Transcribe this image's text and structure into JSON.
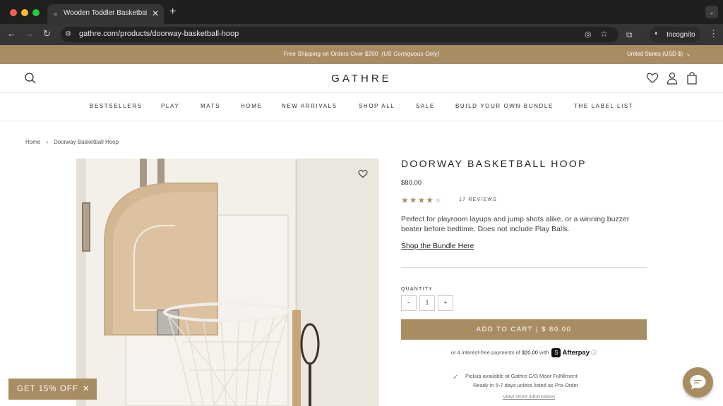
{
  "browser": {
    "tab_title": "Wooden Toddler Basketball H",
    "url": "gathre.com/products/doorway-basketball-hoop",
    "profile_label": "Incognito"
  },
  "announcement": {
    "message": "Free Shipping on Orders Over $200",
    "note": "(US Contiguous Only)",
    "currency": "United States (USD $)"
  },
  "header": {
    "logo": "GATHRE"
  },
  "menu": [
    "BESTSELLERS",
    "PLAY",
    "MATS",
    "HOME",
    "NEW ARRIVALS",
    "SHOP ALL",
    "SALE",
    "BUILD YOUR OWN BUNDLE",
    "THE LABEL LIST"
  ],
  "breadcrumb": {
    "home": "Home",
    "separator": "›",
    "current": "Doorway Basketball Hoop"
  },
  "product": {
    "title": "DOORWAY BASKETBALL HOOP",
    "price": "$80.00",
    "rating": 4,
    "rating_max": 5,
    "reviews": "17 REVIEWS",
    "description": "Perfect for playroom layups and jump shots alike, or a winning buzzer beater before bedtime. Does not include Play Balls.",
    "bundle_link": "Shop the Bundle Here",
    "quantity_label": "QUANTITY",
    "quantity": "1",
    "minus": "−",
    "plus": "+",
    "add_to_cart": "ADD TO CART  |  $ 80.00",
    "afterpay_prefix": "or 4 interest-free payments of",
    "afterpay_amount": "$20.00",
    "afterpay_with": "with",
    "afterpay_brand": "Afterpay",
    "pickup_line1": "Pickup available at Gathre C/O Moor Fulfillment",
    "pickup_line2": "Ready in 5-7 days unless listed as Pre-Order",
    "store_info": "View store information"
  },
  "promo": {
    "label": "GET 15% OFF",
    "close": "✕"
  },
  "colors": {
    "accent": "#a88d63",
    "chrome_dark": "#1f1f1f"
  }
}
